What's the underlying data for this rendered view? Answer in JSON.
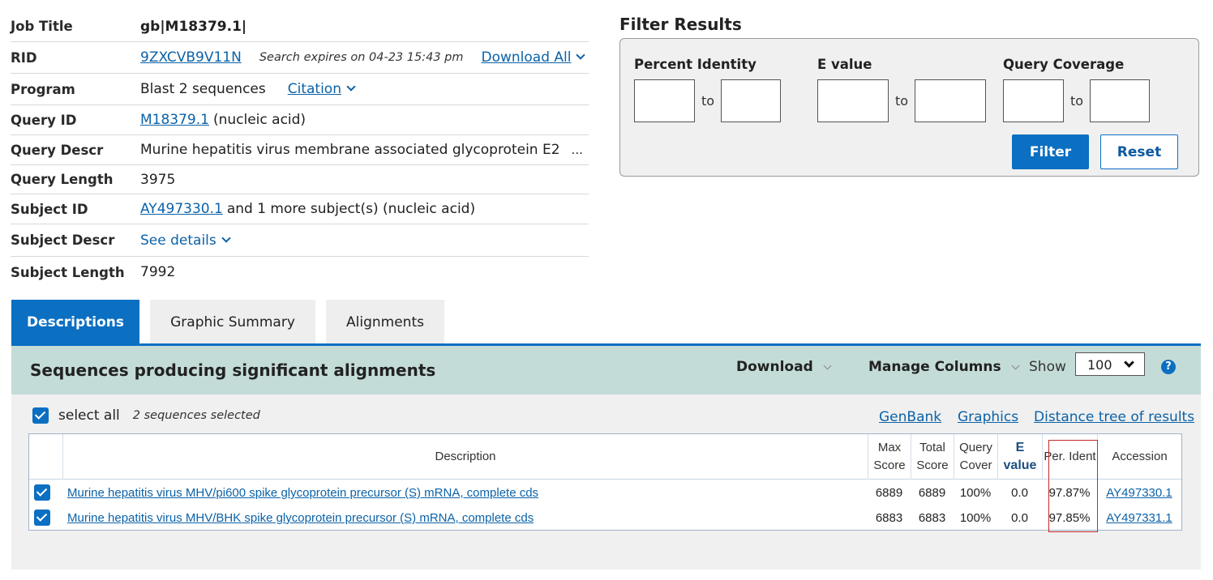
{
  "job": {
    "rows": [
      {
        "key": "Job Title",
        "value": "gb|M18379.1|"
      },
      {
        "key": "RID",
        "value": "9ZXCVB9V11N",
        "extra": "Search expires on 04-23 15:43 pm",
        "action": "Download All"
      },
      {
        "key": "Program",
        "value": "Blast 2 sequences",
        "action": "Citation"
      },
      {
        "key": "Query ID",
        "value": "M18379.1",
        "extra": "(nucleic acid)"
      },
      {
        "key": "Query Descr",
        "value": "Murine hepatitis virus membrane associated glycoprotein E2",
        "extra": "..."
      },
      {
        "key": "Query Length",
        "value": "3975"
      },
      {
        "key": "Subject ID",
        "value": "AY497330.1",
        "extra": "and 1 more subject(s) (nucleic acid)"
      },
      {
        "key": "Subject Descr",
        "value": "See details"
      },
      {
        "key": "Subject Length",
        "value": "7992"
      }
    ]
  },
  "filter": {
    "title": "Filter Results",
    "percent_identity": "Percent Identity",
    "e_value": "E value",
    "query_coverage": "Query Coverage",
    "to": "to",
    "filter_button": "Filter",
    "reset_button": "Reset"
  },
  "tabs": [
    "Descriptions",
    "Graphic Summary",
    "Alignments"
  ],
  "results": {
    "title": "Sequences producing significant alignments",
    "download": "Download",
    "manage_columns": "Manage Columns",
    "show_label": "Show",
    "show_value": "100",
    "help": "?",
    "select_all": "select all",
    "selected_count": "2 sequences selected",
    "links": [
      "GenBank",
      "Graphics",
      "Distance tree of results"
    ],
    "columns": [
      "Description",
      "Max Score",
      "Total Score",
      "Query Cover",
      "E value",
      "Per. Ident",
      "Accession"
    ],
    "rows": [
      {
        "description": "Murine hepatitis virus MHV/pi600 spike glycoprotein precursor (S) mRNA, complete cds",
        "max_score": "6889",
        "total_score": "6889",
        "query_cover": "100%",
        "e_value": "0.0",
        "per_ident": "97.87%",
        "accession": "AY497330.1"
      },
      {
        "description": "Murine hepatitis virus MHV/BHK spike glycoprotein precursor (S) mRNA, complete cds",
        "max_score": "6883",
        "total_score": "6883",
        "query_cover": "100%",
        "e_value": "0.0",
        "per_ident": "97.85%",
        "accession": "AY497331.1"
      }
    ]
  },
  "colors": {
    "accent": "#0b6fc2",
    "header_bg": "#c4dcd7",
    "highlight": "#c62828"
  }
}
